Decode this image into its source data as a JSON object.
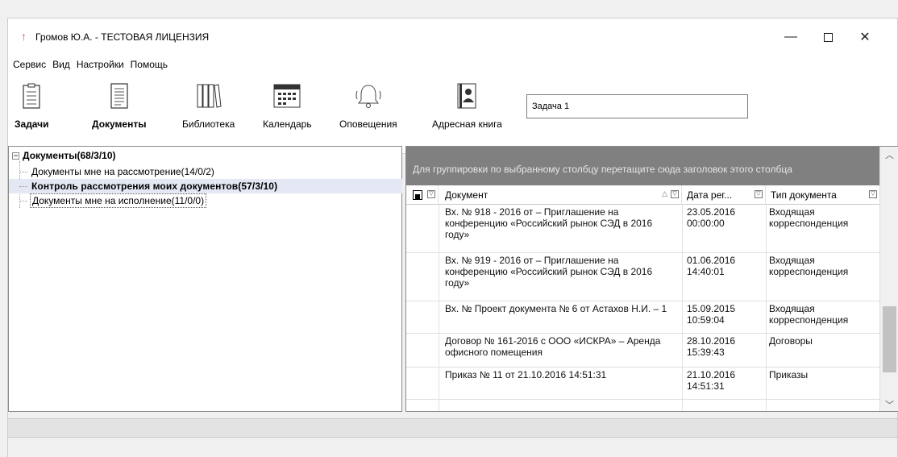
{
  "window": {
    "title": "Громов Ю.А. - ТЕСТОВАЯ ЛИЦЕНЗИЯ",
    "minimize": "—",
    "close": "✕"
  },
  "menu": [
    "Сервис",
    "Вид",
    "Настройки",
    "Помощь"
  ],
  "toolbar": {
    "buttons": [
      {
        "label": "Задачи",
        "icon": "tasks-icon",
        "bold": true
      },
      {
        "label": "Документы",
        "icon": "documents-icon",
        "bold": true
      },
      {
        "label": "Библиотека",
        "icon": "library-icon",
        "bold": false
      },
      {
        "label": "Календарь",
        "icon": "calendar-icon",
        "bold": false
      },
      {
        "label": "Оповещения",
        "icon": "bell-icon",
        "bold": false
      },
      {
        "label": "Адресная книга",
        "icon": "address-book-icon",
        "bold": false
      }
    ],
    "task_field": "Задача 1"
  },
  "tree": {
    "root": "Документы(68/3/10)",
    "items": [
      "Документы мне на рассмотрение(14/0/2)",
      "Контроль рассмотрения моих документов(57/3/10)",
      "Документы мне на исполнение(11/0/0)"
    ]
  },
  "grid": {
    "group_hint": "Для группировки по выбранному столбцу перетащите сюда заголовок этого столбца",
    "columns": {
      "document": "Документ",
      "date": "Дата рег...",
      "type": "Тип документа"
    },
    "rows": [
      {
        "document": "Вх. № 918 - 2016 от  – Приглашение на конференцию «Российский рынок СЭД в 2016 году»",
        "date": "23.05.2016 00:00:00",
        "type": "Входящая корреспонденция"
      },
      {
        "document": "Вх. № 919 - 2016 от  – Приглашение на конференцию «Российский рынок СЭД в 2016 году»",
        "date": "01.06.2016 14:40:01",
        "type": "Входящая корреспонденция"
      },
      {
        "document": "Вх. № Проект документа № 6 от Астахов Н.И. – 1",
        "date": "15.09.2015 10:59:04",
        "type": "Входящая корреспонденция"
      },
      {
        "document": "Договор № 161-2016 с ООО «ИСКРА» – Аренда офисного помещения",
        "date": "28.10.2016 15:39:43",
        "type": "Договоры"
      },
      {
        "document": "Приказ № 11 от 21.10.2016 14:51:31",
        "date": "21.10.2016 14:51:31",
        "type": "Приказы"
      }
    ]
  },
  "colors": {
    "group_area": "#808080",
    "selected_row": "#e3e8f4",
    "title_icon": "#d9534f"
  }
}
